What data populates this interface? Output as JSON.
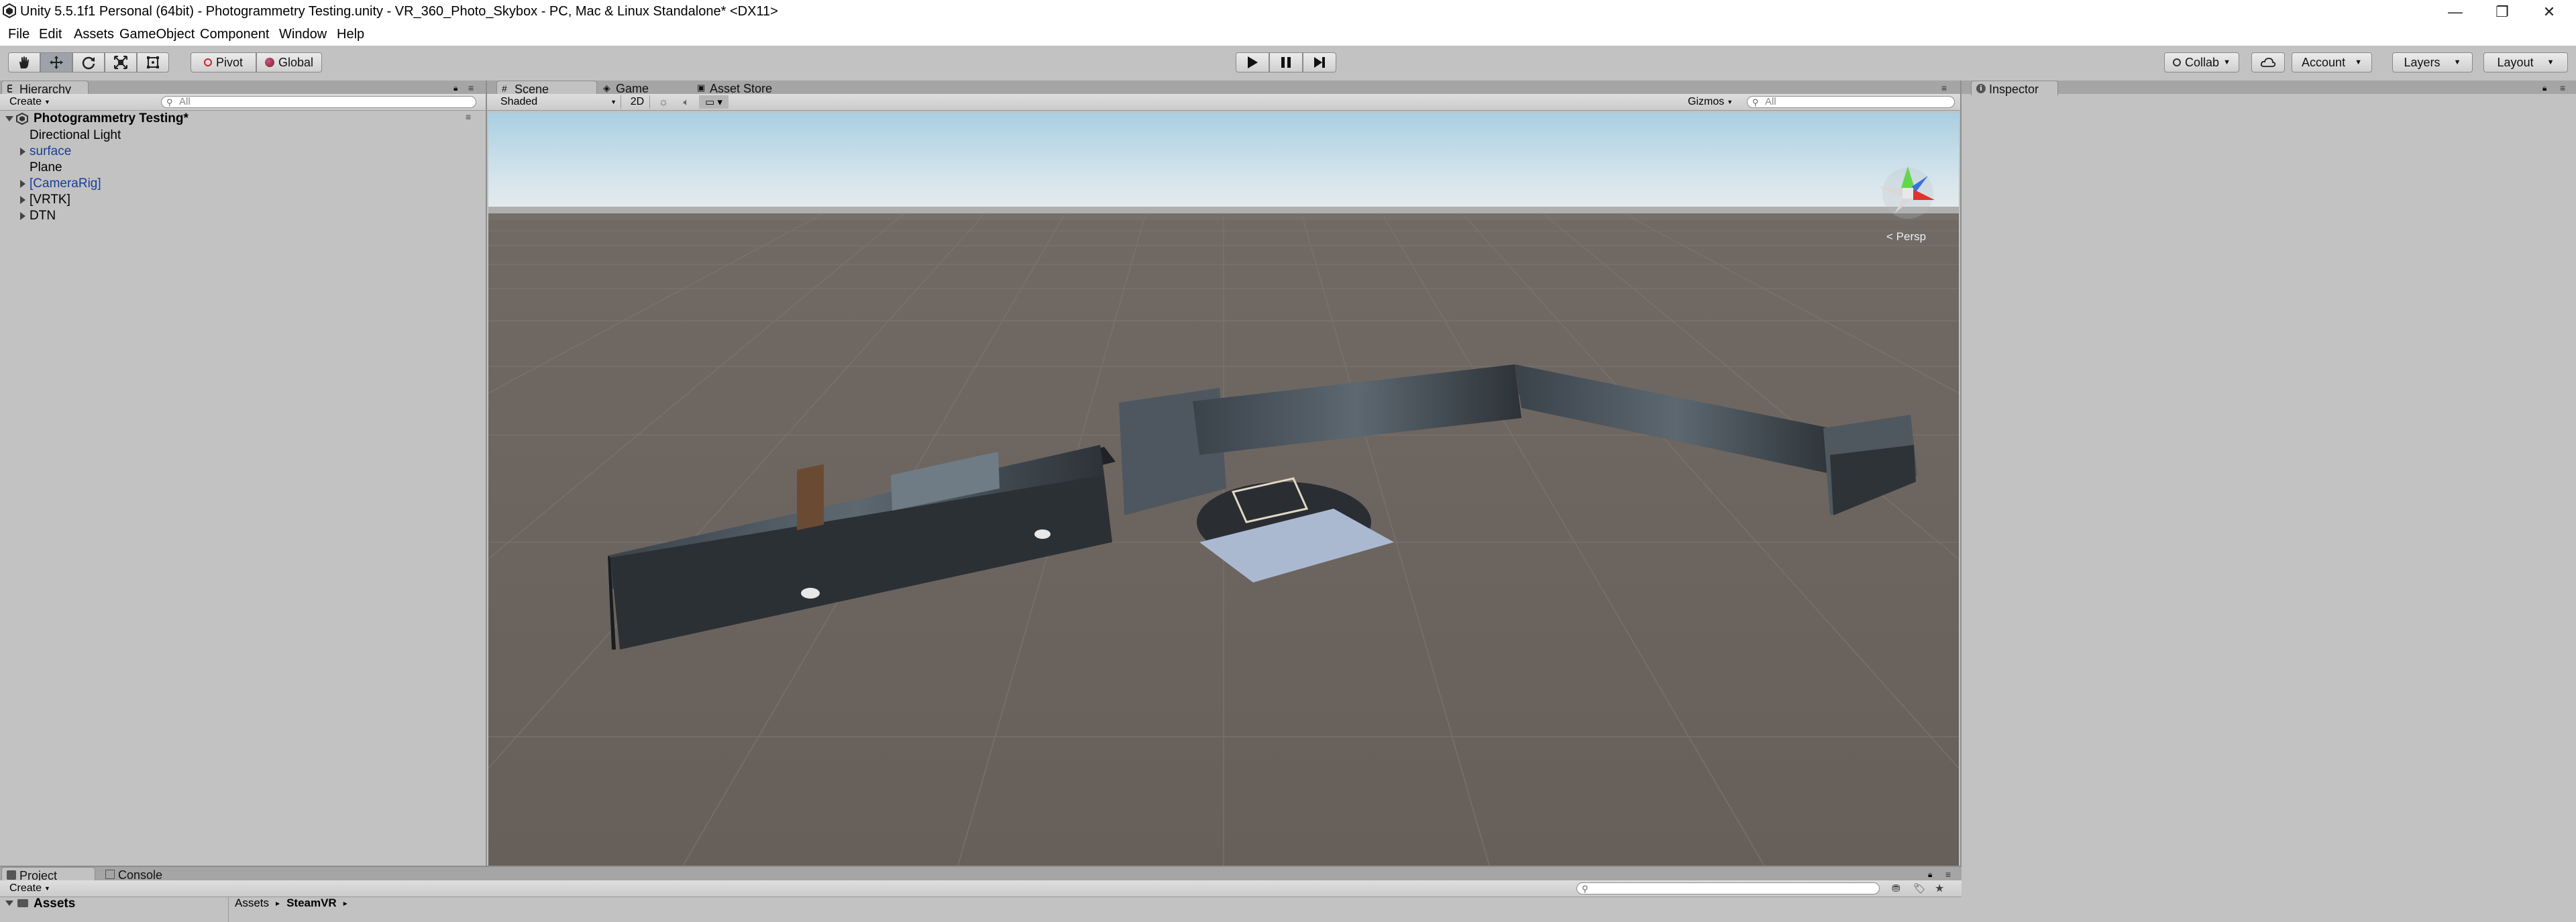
{
  "window": {
    "title": "Unity 5.5.1f1 Personal (64bit) - Photogrammetry Testing.unity - VR_360_Photo_Skybox - PC, Mac & Linux Standalone* <DX11>",
    "minimize": "—",
    "restore": "❐",
    "close": "✕"
  },
  "menu": [
    "File",
    "Edit",
    "Assets",
    "GameObject",
    "Component",
    "Window",
    "Help"
  ],
  "toolbar": {
    "pivot": "Pivot",
    "global": "Global",
    "collab": "Collab",
    "account": "Account",
    "layers": "Layers",
    "layout": "Layout"
  },
  "hierarchy": {
    "tab": "Hierarchy",
    "create": "Create",
    "search_placeholder": "All",
    "scene_name": "Photogrammetry Testing*",
    "items": [
      {
        "label": "Directional Light",
        "style": "normal",
        "expand": false
      },
      {
        "label": "surface",
        "style": "prefab",
        "expand": true
      },
      {
        "label": "Plane",
        "style": "normal",
        "expand": false
      },
      {
        "label": "[CameraRig]",
        "style": "prefab",
        "expand": true
      },
      {
        "label": "[VRTK]",
        "style": "normal",
        "expand": true
      },
      {
        "label": "DTN",
        "style": "normal",
        "expand": true
      }
    ]
  },
  "scene_view": {
    "tabs": [
      "Scene",
      "Game",
      "Asset Store"
    ],
    "shading": "Shaded",
    "mode_2d": "2D",
    "gizmos": "Gizmos",
    "search_placeholder": "All",
    "persp": "< Persp"
  },
  "inspector": {
    "tab": "Inspector"
  },
  "project": {
    "tabs": [
      "Project",
      "Console"
    ],
    "create": "Create",
    "tree_root": "Assets",
    "breadcrumb": [
      "Assets",
      "SteamVR"
    ]
  },
  "colors": {
    "accent": "#3c6ee0",
    "prefab_text": "#1a3d9c",
    "panel": "#c2c2c2"
  }
}
